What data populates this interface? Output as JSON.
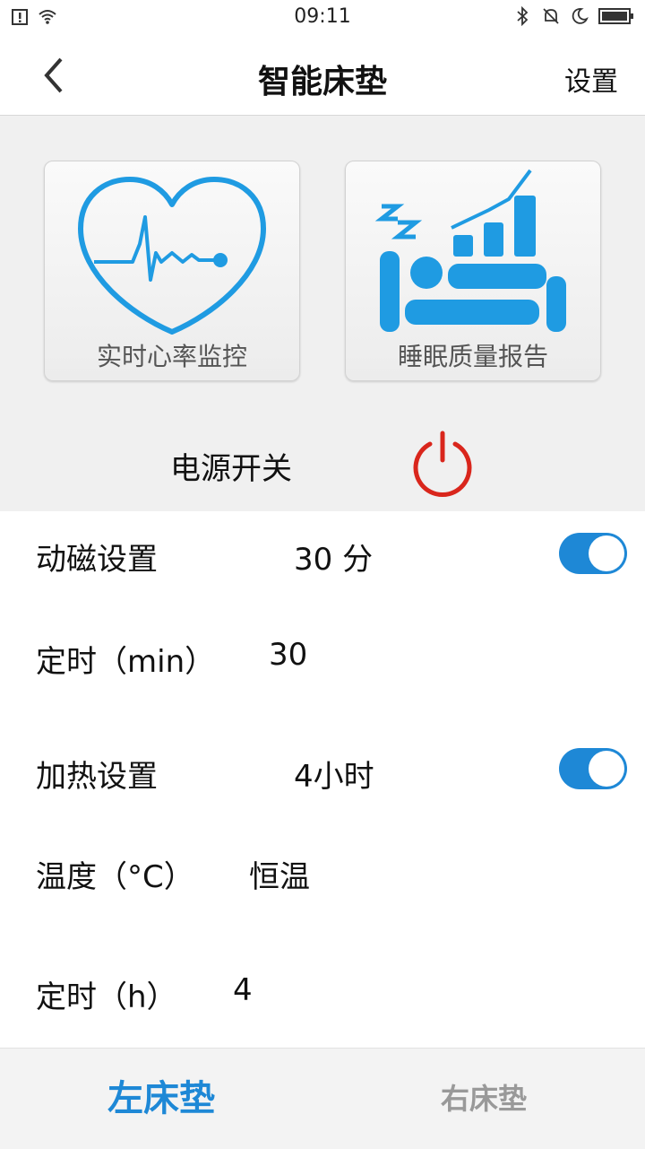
{
  "status": {
    "time": "09:11"
  },
  "header": {
    "title": "智能床垫",
    "settings_label": "设置"
  },
  "cards": {
    "heart_label": "实时心率监控",
    "sleep_label": "睡眠质量报告"
  },
  "power": {
    "label": "电源开关",
    "color": "#d9261c"
  },
  "magnetic": {
    "label": "动磁设置",
    "value": "30 分",
    "enabled": true
  },
  "timer_min": {
    "label": "定时（min）",
    "value": "30"
  },
  "heating": {
    "label": "加热设置",
    "value": "4小时",
    "enabled": true
  },
  "temperature": {
    "label": "温度（°C）",
    "value": "恒温"
  },
  "timer_h": {
    "label": "定时（h）",
    "value": "4"
  },
  "tabs": {
    "left": "左床垫",
    "right": "右床垫"
  },
  "colors": {
    "accent": "#1e88d6",
    "icon_blue": "#1f9be2",
    "power_red": "#d9261c"
  }
}
